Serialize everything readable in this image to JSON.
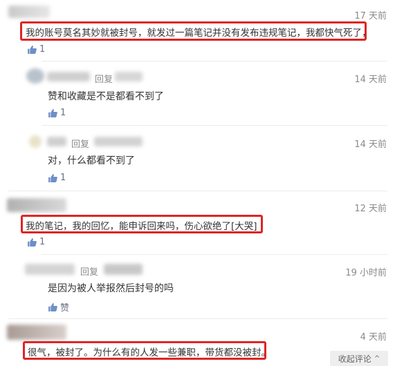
{
  "comments": [
    {
      "time": "17 天前",
      "text": "我的账号莫名其妙就被封号，就发过一篇笔记并没有发布违规笔记，我都快气死了，",
      "likes": "1",
      "replies": [
        {
          "reply_word": "回复",
          "time": "14 天前",
          "text": "赞和收藏是不是都看不到了",
          "likes": "1"
        },
        {
          "reply_word": "回复",
          "time": "14 天前",
          "text": "对，什么都看不到了",
          "likes": "1"
        }
      ]
    },
    {
      "time": "12 天前",
      "text": "我的笔记，我的回忆，能申诉回来吗，伤心欲绝了[大哭]",
      "likes": "1",
      "replies": [
        {
          "reply_word": "回复",
          "time": "19 小时前",
          "text": "是因为被人举报然后封号的吗",
          "likes": "赞"
        }
      ]
    },
    {
      "time": "4 天前",
      "text": "很气，被封了。为什么有的人发一些兼职，带货都没被封。"
    }
  ],
  "collapse_label": "收起评论",
  "colors": {
    "highlight": "#e02424",
    "like_icon": "#6e8fc7",
    "muted": "#8a8a8a"
  }
}
